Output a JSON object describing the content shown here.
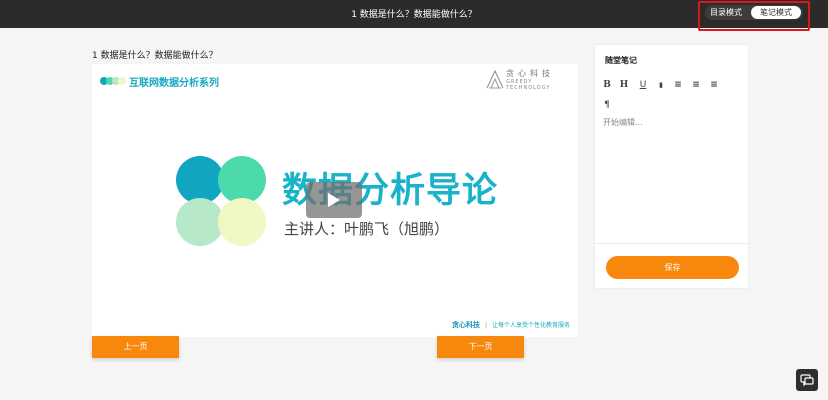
{
  "header": {
    "title": "1 数据是什么？数据能做什么？",
    "modes": {
      "directory": "目录模式",
      "notes": "笔记模式",
      "active": "notes"
    }
  },
  "lesson": {
    "title": "1 数据是什么？数据能做什么？",
    "slide": {
      "series": "互联网数据分析系列",
      "company_cn": "贪心科技",
      "company_en": "GREEDY TECHNOLOGY",
      "heading": "数据分析导论",
      "lecturer": "主讲人：叶鹏飞（旭鹏）",
      "footer_brand": "贪心科技",
      "footer_separator": "|",
      "footer_slogan": "让每个人享受个性化教育服务",
      "circle_colors": [
        "#10a5c1",
        "#4cd9ac",
        "#b7e8c7",
        "#f0f9c3"
      ]
    },
    "prev_label": "上一页",
    "next_label": "下一页"
  },
  "notes": {
    "title": "随堂笔记",
    "toolbar": [
      {
        "name": "bold-icon",
        "glyph": "B"
      },
      {
        "name": "heading-icon",
        "glyph": "H"
      },
      {
        "name": "underline-icon",
        "glyph": "U"
      },
      {
        "name": "bookmark-icon",
        "glyph": "▮"
      },
      {
        "name": "align-left-icon",
        "glyph": "≡"
      },
      {
        "name": "align-center-icon",
        "glyph": "≡"
      },
      {
        "name": "align-right-icon",
        "glyph": "≡"
      },
      {
        "name": "quote-icon",
        "glyph": "¶"
      }
    ],
    "placeholder": "开始编辑...",
    "save_label": "保存"
  },
  "accent_color": "#f7880d",
  "brand_color": "#18b3c8"
}
